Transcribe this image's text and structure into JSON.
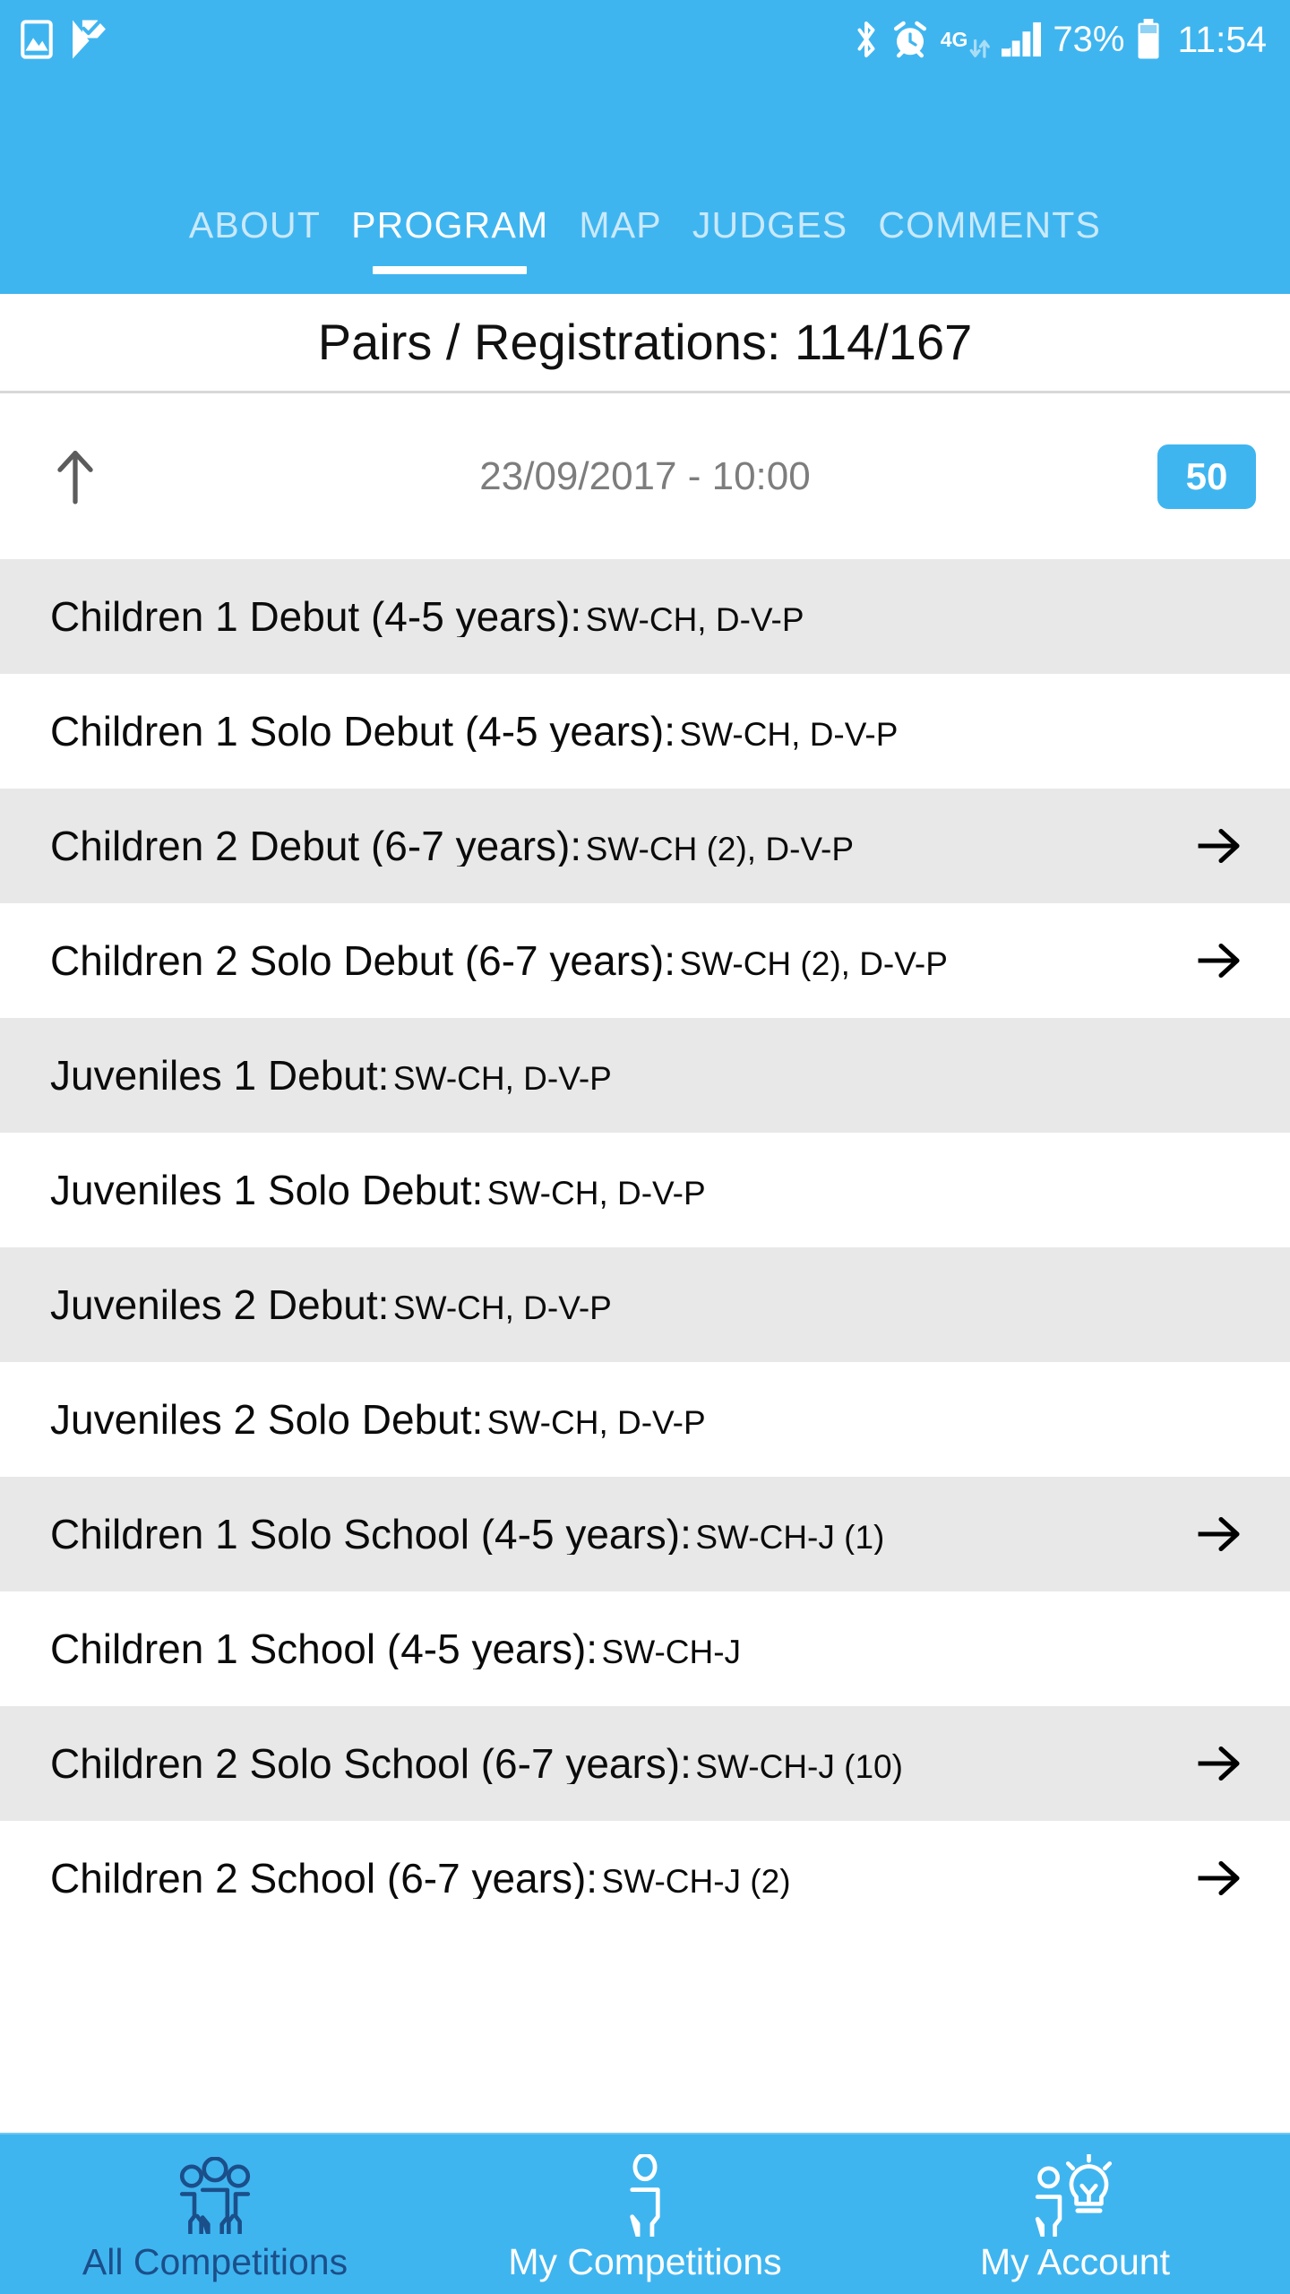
{
  "statusbar": {
    "left_icons": [
      "image-icon",
      "checkmark-flag-icon"
    ],
    "right_icons": [
      "bluetooth-icon",
      "alarm-icon",
      "4g-data-icon",
      "signal-bars-icon",
      "battery-icon"
    ],
    "network_label": "4G",
    "battery_percent": "73%",
    "clock": "11:54"
  },
  "tabs": [
    {
      "label": "ABOUT",
      "active": false
    },
    {
      "label": "PROGRAM",
      "active": true
    },
    {
      "label": "MAP",
      "active": false
    },
    {
      "label": "JUDGES",
      "active": false
    },
    {
      "label": "COMMENTS",
      "active": false
    }
  ],
  "header": {
    "title": "Pairs / Registrations: 114/167"
  },
  "session": {
    "sort_icon": "arrow-up-icon",
    "datetime": "23/09/2017 - 10:00",
    "count_badge": "50"
  },
  "program_rows": [
    {
      "title": "Children 1 Debut (4-5 years):",
      "codes": "SW-CH, D-V-P",
      "arrow": false,
      "shaded": true
    },
    {
      "title": "Children 1 Solo Debut (4-5 years):",
      "codes": "SW-CH, D-V-P",
      "arrow": false,
      "shaded": false
    },
    {
      "title": "Children 2 Debut (6-7 years):",
      "codes": "SW-CH (2), D-V-P",
      "arrow": true,
      "shaded": true
    },
    {
      "title": "Children 2 Solo Debut (6-7 years):",
      "codes": "SW-CH (2), D-V-P",
      "arrow": true,
      "shaded": false
    },
    {
      "title": "Juveniles 1 Debut:",
      "codes": "SW-CH, D-V-P",
      "arrow": false,
      "shaded": true
    },
    {
      "title": "Juveniles 1 Solo Debut:",
      "codes": "SW-CH, D-V-P",
      "arrow": false,
      "shaded": false
    },
    {
      "title": "Juveniles 2 Debut:",
      "codes": "SW-CH, D-V-P",
      "arrow": false,
      "shaded": true
    },
    {
      "title": "Juveniles 2 Solo Debut:",
      "codes": "SW-CH, D-V-P",
      "arrow": false,
      "shaded": false
    },
    {
      "title": "Children 1 Solo School (4-5 years):",
      "codes": "SW-CH-J (1)",
      "arrow": true,
      "shaded": true
    },
    {
      "title": "Children 1 School (4-5 years):",
      "codes": "SW-CH-J",
      "arrow": false,
      "shaded": false
    },
    {
      "title": "Children 2 Solo School (6-7 years):",
      "codes": "SW-CH-J (10)",
      "arrow": true,
      "shaded": true
    },
    {
      "title": "Children 2 School (6-7 years):",
      "codes": "SW-CH-J (2)",
      "arrow": true,
      "shaded": false
    }
  ],
  "bottom_nav": [
    {
      "label": "All Competitions",
      "icon": "group-people-icon",
      "active": true
    },
    {
      "label": "My Competitions",
      "icon": "person-icon",
      "active": false
    },
    {
      "label": "My Account",
      "icon": "person-lightbulb-icon",
      "active": false
    }
  ],
  "colors": {
    "brand_blue": "#3FB5F0",
    "tab_inactive": "#C9E9FA",
    "row_shaded": "#E8E8E8",
    "active_nav": "#1B4F8A",
    "muted_text": "#7D7D7D"
  }
}
